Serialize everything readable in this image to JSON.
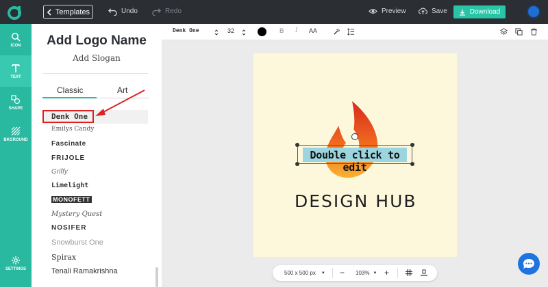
{
  "topbar": {
    "templates_label": "Templates",
    "undo_label": "Undo",
    "redo_label": "Redo",
    "preview_label": "Preview",
    "save_label": "Save",
    "download_label": "Download"
  },
  "rail": {
    "items": [
      {
        "label": "ICON"
      },
      {
        "label": "TEXT"
      },
      {
        "label": "SHAPE"
      },
      {
        "label": "BKGROUND"
      },
      {
        "label": "SETTINGS"
      }
    ]
  },
  "panel": {
    "title": "Add Logo Name",
    "slogan": "Add Slogan",
    "tabs": [
      "Classic",
      "Art"
    ],
    "fonts": [
      "Denk One",
      "Emilys Candy",
      "Fascinate",
      "FRIJOLE",
      "Griffy",
      "Limelight",
      "MONOFETT",
      "Mystery Quest",
      "NOSIFER",
      "Snowburst One",
      "Spirax",
      "Tenali Ramakrishna"
    ]
  },
  "toolbar": {
    "font_name": "Denk One",
    "font_size": "32",
    "bold": "B",
    "italic": "I",
    "case": "AA",
    "text_color": "#000000"
  },
  "canvas": {
    "selected_text": "Double click to edit",
    "brand": "DESIGN HUB",
    "background": "#fdf8dc"
  },
  "zoombar": {
    "size": "500 x 500 px",
    "zoom": "103%",
    "minus": "−",
    "plus": "+"
  },
  "colors": {
    "accent": "#29b9a0",
    "topbar": "#2b2e33",
    "download": "#28c4a6",
    "annotation": "#e02020"
  }
}
